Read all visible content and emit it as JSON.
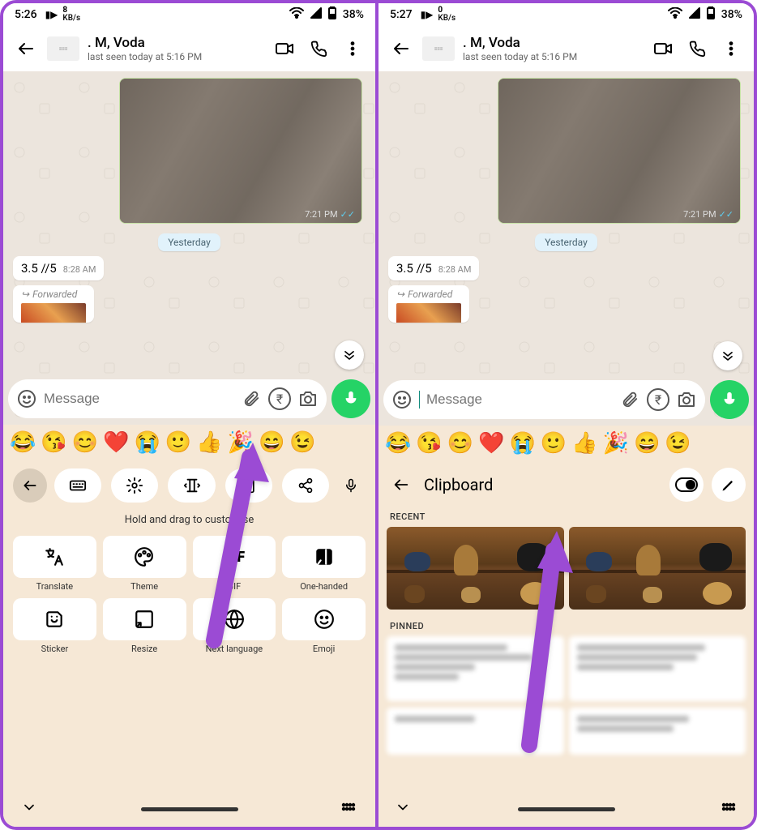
{
  "left": {
    "status": {
      "time": "5:26",
      "speed_num": "8",
      "speed_unit": "KB/s",
      "battery": "38%"
    },
    "chat": {
      "name": ". M, Voda",
      "sub": "last seen today at 5:16 PM",
      "img_time": "7:21 PM",
      "date_chip": "Yesterday",
      "msg_text": "3.5 //5",
      "msg_time": "8:28 AM",
      "forwarded": "Forwarded",
      "placeholder": "Message"
    },
    "kb": {
      "hint": "Hold and drag to customise",
      "cells": [
        {
          "label": "Translate",
          "icon": "translate"
        },
        {
          "label": "Theme",
          "icon": "palette"
        },
        {
          "label": "GIF",
          "icon": "gif"
        },
        {
          "label": "One-handed",
          "icon": "onehand"
        },
        {
          "label": "Sticker",
          "icon": "sticker"
        },
        {
          "label": "Resize",
          "icon": "resize"
        },
        {
          "label": "Next language",
          "icon": "globe"
        },
        {
          "label": "Emoji",
          "icon": "emoji"
        }
      ]
    }
  },
  "right": {
    "status": {
      "time": "5:27",
      "speed_num": "0",
      "speed_unit": "KB/s",
      "battery": "38%"
    },
    "chat": {
      "name": ". M, Voda",
      "sub": "last seen today at 5:16 PM",
      "img_time": "7:21 PM",
      "date_chip": "Yesterday",
      "msg_text": "3.5 //5",
      "msg_time": "8:28 AM",
      "forwarded": "Forwarded",
      "placeholder": "Message"
    },
    "clipboard": {
      "title": "Clipboard",
      "recent": "RECENT",
      "pinned": "PINNED"
    }
  },
  "emojis": [
    "😂",
    "😘",
    "😊",
    "❤️",
    "😭",
    "🙂",
    "👍",
    "🎉",
    "😄",
    "😉"
  ]
}
